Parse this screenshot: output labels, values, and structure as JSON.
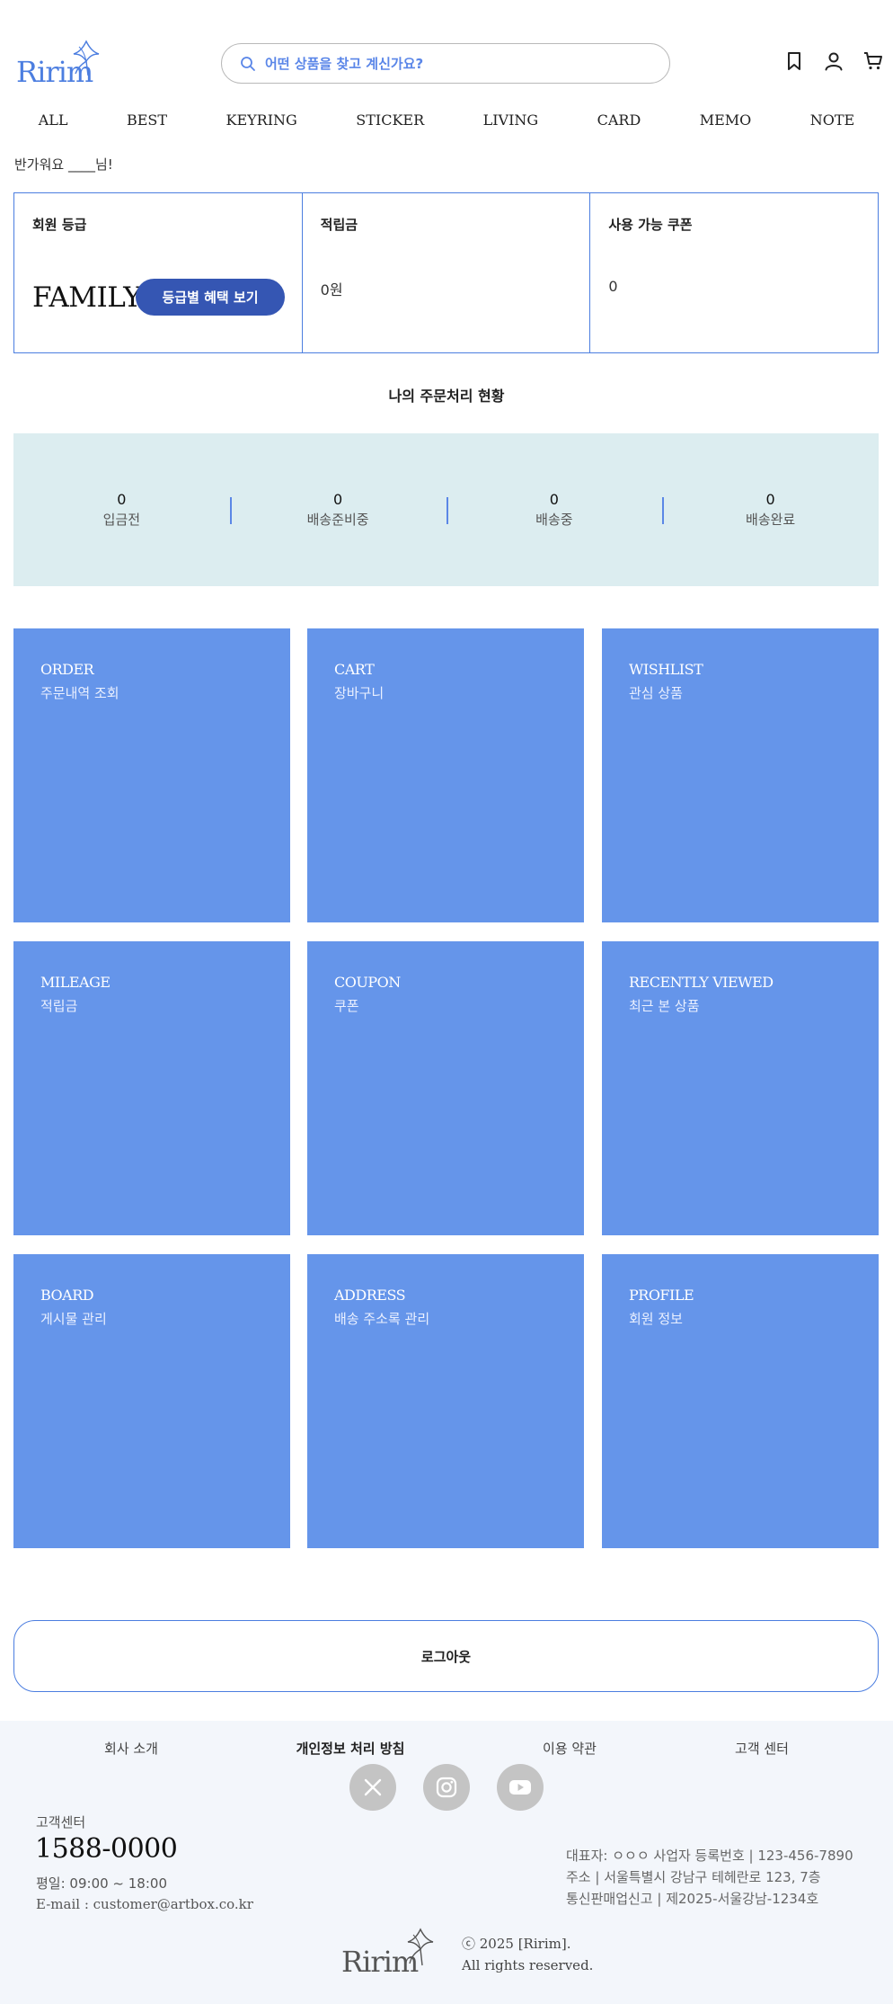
{
  "header": {
    "logo_text": "Ririm",
    "search_placeholder": "어떤 상품을 찾고 계신가요?"
  },
  "nav": [
    "ALL",
    "BEST",
    "KEYRING",
    "STICKER",
    "LIVING",
    "CARD",
    "MEMO",
    "NOTE"
  ],
  "welcome": "반가워요 ____님!",
  "summary": {
    "grade_title": "회원 등급",
    "grade_value": "FAMILY",
    "grade_button": "등급별 혜택 보기",
    "mileage_title": "적립금",
    "mileage_value": "0원",
    "coupon_title": "사용 가능 쿠폰",
    "coupon_value": "0"
  },
  "order_status": {
    "title": "나의 주문처리 현황",
    "items": [
      {
        "count": "0",
        "label": "입금전"
      },
      {
        "count": "0",
        "label": "배송준비중"
      },
      {
        "count": "0",
        "label": "배송중"
      },
      {
        "count": "0",
        "label": "배송완료"
      }
    ]
  },
  "tiles": [
    {
      "en": "ORDER",
      "ko": "주문내역 조회"
    },
    {
      "en": "CART",
      "ko": "장바구니"
    },
    {
      "en": "WISHLIST",
      "ko": "관심 상품"
    },
    {
      "en": "MILEAGE",
      "ko": "적립금"
    },
    {
      "en": "COUPON",
      "ko": "쿠폰"
    },
    {
      "en": "RECENTLY VIEWED",
      "ko": "최근 본 상품"
    },
    {
      "en": "BOARD",
      "ko": "게시물 관리"
    },
    {
      "en": "ADDRESS",
      "ko": "배송 주소록 관리"
    },
    {
      "en": "PROFILE",
      "ko": "회원 정보"
    }
  ],
  "logout_label": "로그아웃",
  "footer": {
    "links": [
      "회사 소개",
      "개인정보 처리 방침",
      "이용 약관",
      "고객 센터"
    ],
    "social": [
      "x-icon",
      "instagram-icon",
      "youtube-icon"
    ],
    "cs_label": "고객센터",
    "cs_phone": "1588-0000",
    "cs_hours": "평일: 09:00 ~ 18:00",
    "cs_email": "E-mail : customer@artbox.co.kr",
    "company_line1": "대표자: ㅇㅇㅇ 사업자 등록번호 | 123-456-7890",
    "company_line2": "주소 | 서울특별시 강남구 테헤란로 123, 7층",
    "company_line3": "통신판매업신고 | 제2025-서울강남-1234호",
    "logo_text": "Ririm",
    "copyright_line1": "ⓒ 2025 [Ririm].",
    "copyright_line2": "All rights reserved."
  },
  "colors": {
    "accent": "#4c7ee0",
    "tile": "#6595ea",
    "button": "#3556b3",
    "status_bg": "#dcedf0",
    "footer_bg": "#f3f6fb"
  }
}
